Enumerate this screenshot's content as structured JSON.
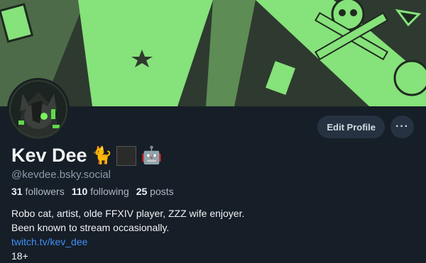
{
  "profile": {
    "display_name": "Kev Dee",
    "name_emojis": [
      "🐈",
      "🤖"
    ],
    "handle": "@kevdee.bsky.social",
    "stats": {
      "followers_count": "31",
      "followers_label": "followers",
      "following_count": "110",
      "following_label": "following",
      "posts_count": "25",
      "posts_label": "posts"
    },
    "bio": {
      "line1": "Robo cat, artist, olde FFXIV player, ZZZ wife enjoyer.",
      "line2": "Been known to stream occasionally.",
      "link": "twitch.tv/kev_dee",
      "line4": "18+"
    }
  },
  "actions": {
    "edit_profile_label": "Edit Profile",
    "more_label": "···"
  },
  "colors": {
    "background": "#161e27",
    "banner_green": "#86e27a",
    "banner_dark": "#2e3a2f",
    "link": "#3d8ff5",
    "button_bg": "#263241"
  },
  "icons": {
    "banner": "skull-crossbones-art",
    "avatar": "robot-cat-avatar"
  }
}
